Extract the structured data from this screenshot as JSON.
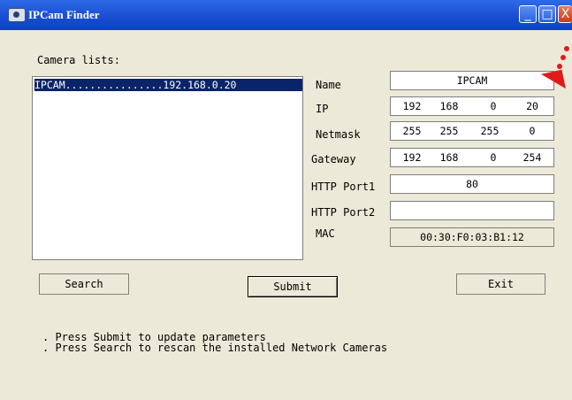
{
  "window": {
    "title": "IPCam Finder",
    "min": "_",
    "max": "□",
    "close": "X"
  },
  "camera_list": {
    "heading": "Camera lists:",
    "items": [
      "IPCAM................192.168.0.20"
    ]
  },
  "form": {
    "name_label": "Name",
    "name_value": "IPCAM",
    "ip_label": "IP",
    "ip": [
      "192",
      "168",
      "0",
      "20"
    ],
    "netmask_label": "Netmask",
    "netmask": [
      "255",
      "255",
      "255",
      "0"
    ],
    "gateway_label": "Gateway",
    "gateway": [
      "192",
      "168",
      "0",
      "254"
    ],
    "http1_label": "HTTP Port1",
    "http1_value": "80",
    "http2_label": "HTTP Port2",
    "http2_value": "",
    "mac_label": "MAC",
    "mac_value": "00:30:F0:03:B1:12"
  },
  "buttons": {
    "search": "Search",
    "submit": "Submit",
    "exit": "Exit"
  },
  "help": [
    ". Press Submit to update parameters",
    ". Press Search to rescan the installed Network Cameras"
  ],
  "colors": {
    "annotation": "#e01b1b",
    "selection": "#0a246a"
  }
}
